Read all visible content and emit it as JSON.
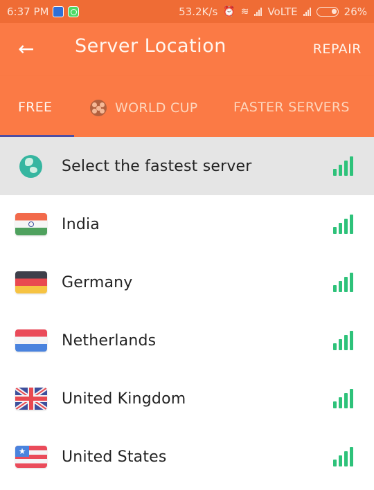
{
  "statusbar": {
    "time": "6:37 PM",
    "speed": "53.2K/s",
    "network": "VoLTE",
    "battery": "26%",
    "icons": [
      "photo-app-icon",
      "whatsapp-icon",
      "alarm-icon",
      "wifi-icon",
      "signal-icon",
      "battery-icon"
    ]
  },
  "appbar": {
    "back_icon": "←",
    "title": "Server Location",
    "action": "REPAIR"
  },
  "tabs": [
    {
      "label": "FREE",
      "active": true
    },
    {
      "label": "WORLD CUP",
      "icon": "soccer-ball-icon",
      "active": false
    },
    {
      "label": "FASTER SERVERS",
      "active": false
    }
  ],
  "colors": {
    "primary": "#fb7a45",
    "statusbar": "#ef6c35",
    "indicator": "#4d4ea3",
    "signal": "#2ec27a"
  },
  "servers": [
    {
      "name": "Select the fastest server",
      "icon": "globe-icon",
      "signal_bars": 4
    },
    {
      "name": "India",
      "icon": "india-flag-icon",
      "signal_bars": 4
    },
    {
      "name": "Germany",
      "icon": "germany-flag-icon",
      "signal_bars": 4
    },
    {
      "name": "Netherlands",
      "icon": "netherlands-flag-icon",
      "signal_bars": 4
    },
    {
      "name": "United Kingdom",
      "icon": "uk-flag-icon",
      "signal_bars": 4
    },
    {
      "name": "United States",
      "icon": "us-flag-icon",
      "signal_bars": 4
    }
  ]
}
